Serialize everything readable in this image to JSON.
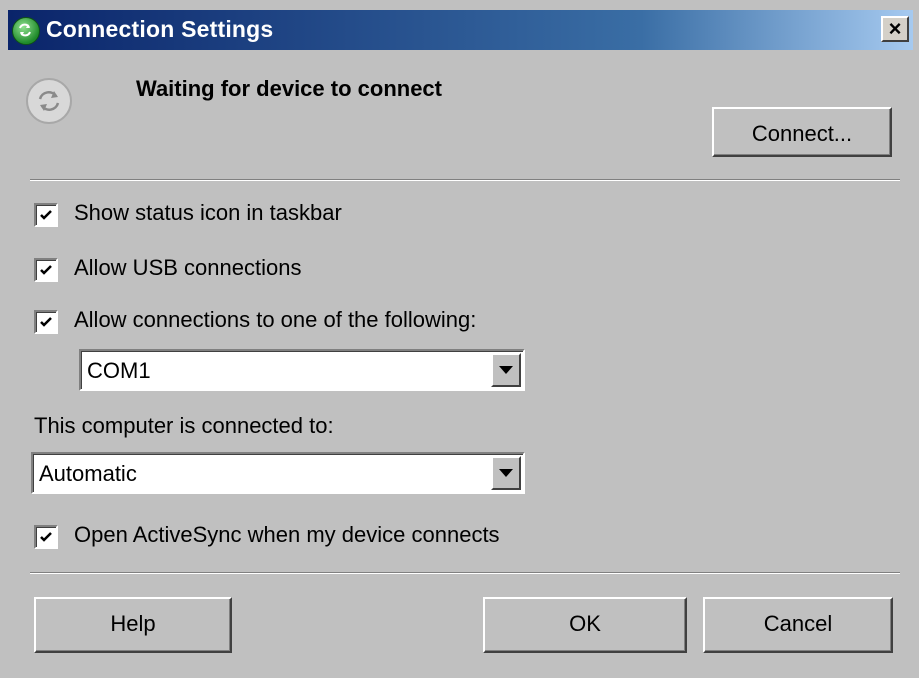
{
  "window": {
    "title": "Connection Settings",
    "close_glyph": "×"
  },
  "status": {
    "icon": "sync-arrows-icon",
    "text": "Waiting for device to connect",
    "connect_label": "Connect..."
  },
  "options": {
    "show_status_icon": {
      "label": "Show status icon in taskbar",
      "checked": true
    },
    "allow_usb": {
      "label": "Allow USB connections",
      "checked": true
    },
    "allow_serial": {
      "label": "Allow connections to one of the following:",
      "checked": true
    },
    "port_select": {
      "value": "COM1"
    },
    "connected_to_label": "This computer is connected to:",
    "connected_to_select": {
      "value": "Automatic"
    },
    "open_activesync": {
      "label": "Open ActiveSync when my device connects",
      "checked": true
    }
  },
  "footer": {
    "help_label": "Help",
    "ok_label": "OK",
    "cancel_label": "Cancel"
  },
  "colors": {
    "title_gradient_start": "#0a246a",
    "title_gradient_end": "#a6caf0",
    "dialog_background": "#c0c0c0"
  }
}
